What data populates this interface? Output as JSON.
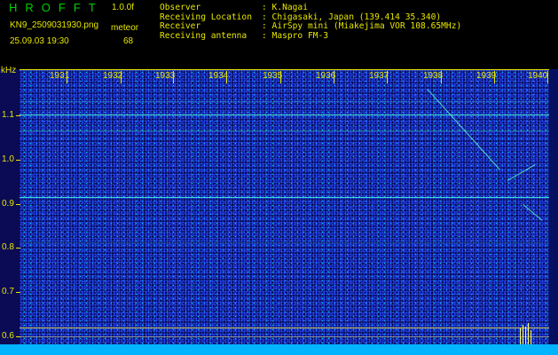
{
  "header": {
    "app_title": "HROFFT",
    "version": "1.0.0f",
    "filename": "KN9_2509031930.png",
    "meteor_label": "meteor",
    "datetime": "25.09.03 19:30",
    "meteor_count": "68",
    "info": [
      {
        "key": "Observer",
        "value": ": K.Nagai"
      },
      {
        "key": "Receiving Location",
        "value": ": Chigasaki, Japan (139.414 35.340)"
      },
      {
        "key": "Receiver",
        "value": ": AirSpy mini (Miakejima VOR 108.65MHz)"
      },
      {
        "key": "Receiving antenna",
        "value": ": Maspro FM-3"
      }
    ]
  },
  "plot": {
    "y_unit": "kHz",
    "y_ticks": [
      "1.1",
      "1.0",
      "0.9",
      "0.8",
      "0.7",
      "0.6"
    ],
    "x_ticks": [
      "1931",
      "1932",
      "1933",
      "1934",
      "1935",
      "1936",
      "1937",
      "1938",
      "1939",
      "1940"
    ]
  }
}
